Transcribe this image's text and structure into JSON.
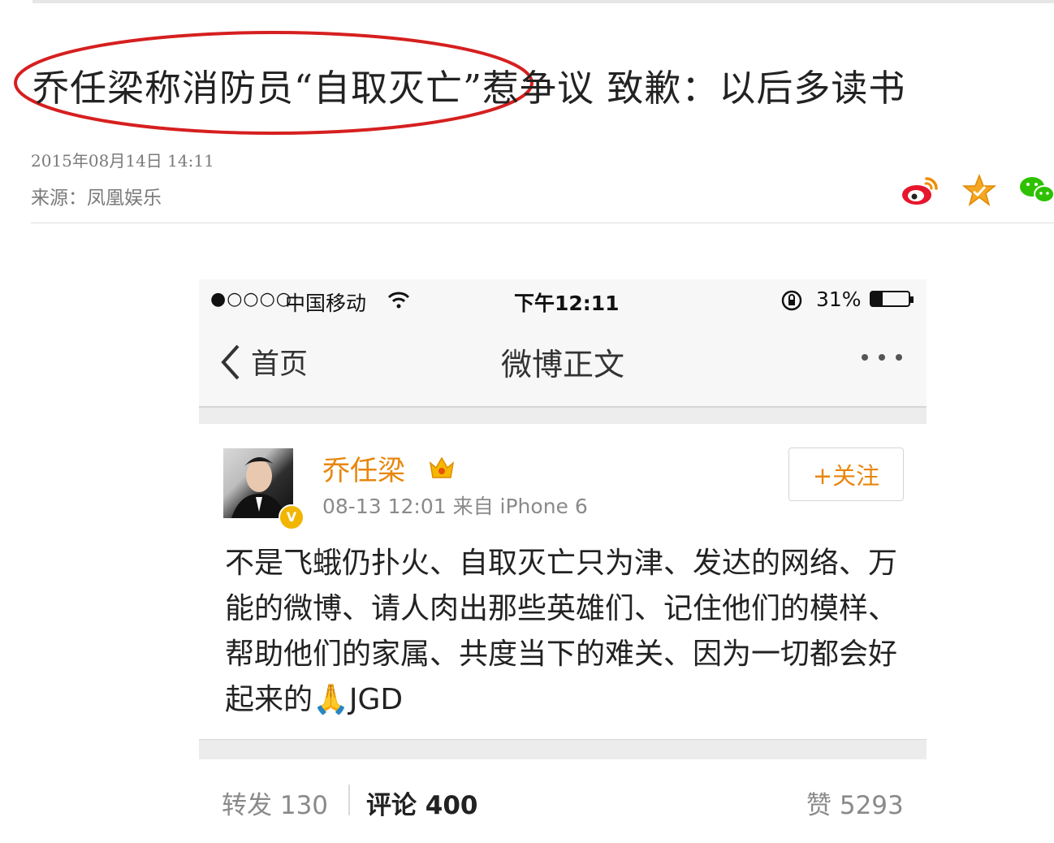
{
  "article": {
    "headline": "乔任梁称消防员“自取灭亡”惹争议 致歉：以后多读书",
    "date": "2015年08月14日 14:11",
    "source": "来源：凤凰娱乐",
    "share_icons": [
      "weibo-icon",
      "star-icon",
      "wechat-icon"
    ],
    "highlight_color": "#d61f1f"
  },
  "phone": {
    "status_bar": {
      "signal": "●○○○○",
      "carrier": "中国移动",
      "time": "下午12:11",
      "battery": "31%",
      "battery_level": 0.31
    },
    "nav": {
      "back_label": "首页",
      "title": "微博正文"
    },
    "post": {
      "user_name": "乔任梁",
      "verified_badge": "V",
      "time_source": "08-13 12:01   来自 iPhone 6",
      "follow_label": "+关注",
      "body": "不是飞蛾仍扑火、自取灭亡只为津、发达的网络、万能的微博、请人肉出那些英雄们、记住他们的模样、帮助他们的家属、共度当下的难关、因为一切都会好起来的🙏JGD",
      "repost": "转发 130",
      "comment": "评论 400",
      "like": "赞 5293"
    },
    "colors": {
      "accent": "#e8860c",
      "badge": "#f2b500"
    }
  }
}
